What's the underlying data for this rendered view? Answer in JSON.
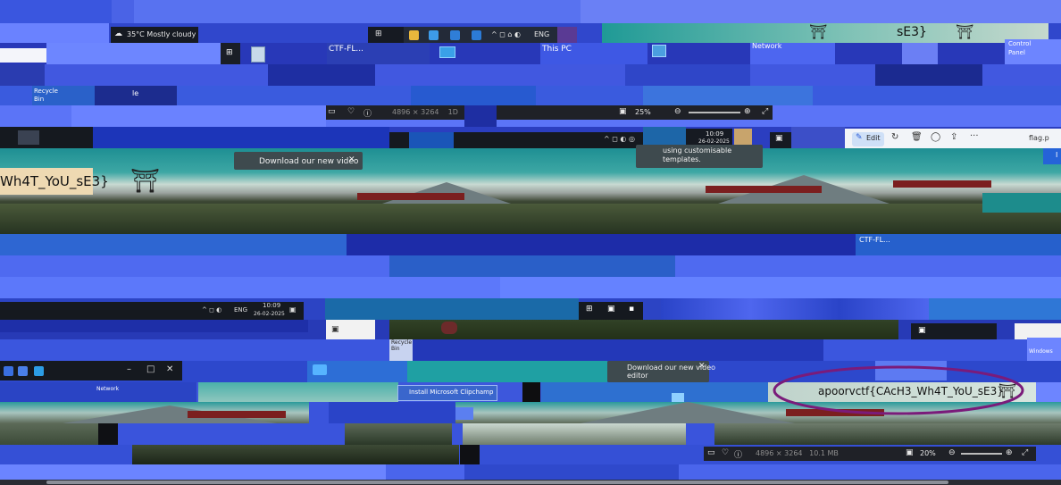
{
  "weather": {
    "text": "35°C Mostly cloudy"
  },
  "desktop_labels": {
    "ctf_file": "CTF-FL...",
    "this_pc": "This PC",
    "network": "Network",
    "control_panel": "Control\nPanel",
    "recycle_bin": "Recycle\nBin",
    "recycle_bin_suffix": "le",
    "windows_file": "Windows",
    "ctf_file_2": "CTF-FL..."
  },
  "flag_fragments": {
    "top_right": "sE3}",
    "left": "Wh4T_YoU_sE3}",
    "circled": "apoorvctf{CAcH3_Wh4T_YoU_sE3}"
  },
  "photos_viewer": {
    "info": "4896 × 3264    1D      .1 MB",
    "info_bottom": "4896 × 3264   10.1 MB",
    "zoom": "25%",
    "zoom_bottom": "20%",
    "edit_label": "Edit",
    "filename": "flag.p",
    "more": "···"
  },
  "popups": {
    "download_video": "Download our new video",
    "download_video_bottom": "Download our new video\neditor",
    "templates": "using customisable\ntemplates.",
    "install_clipchamp": "Install Microsoft Clipchamp"
  },
  "taskbar": {
    "time": "10:09",
    "date": "26-02-2025",
    "lang": "ENG",
    "time_mid": "10:09",
    "date_mid": "26-02-2025",
    "lang_mid": "ENG"
  },
  "window_controls": {
    "minimize": "–",
    "maximize": "□",
    "close": "✕"
  },
  "colors": {
    "accent": "#3d55d8",
    "ellipse": "#7a1b7a",
    "taskbar": "#161a22"
  }
}
